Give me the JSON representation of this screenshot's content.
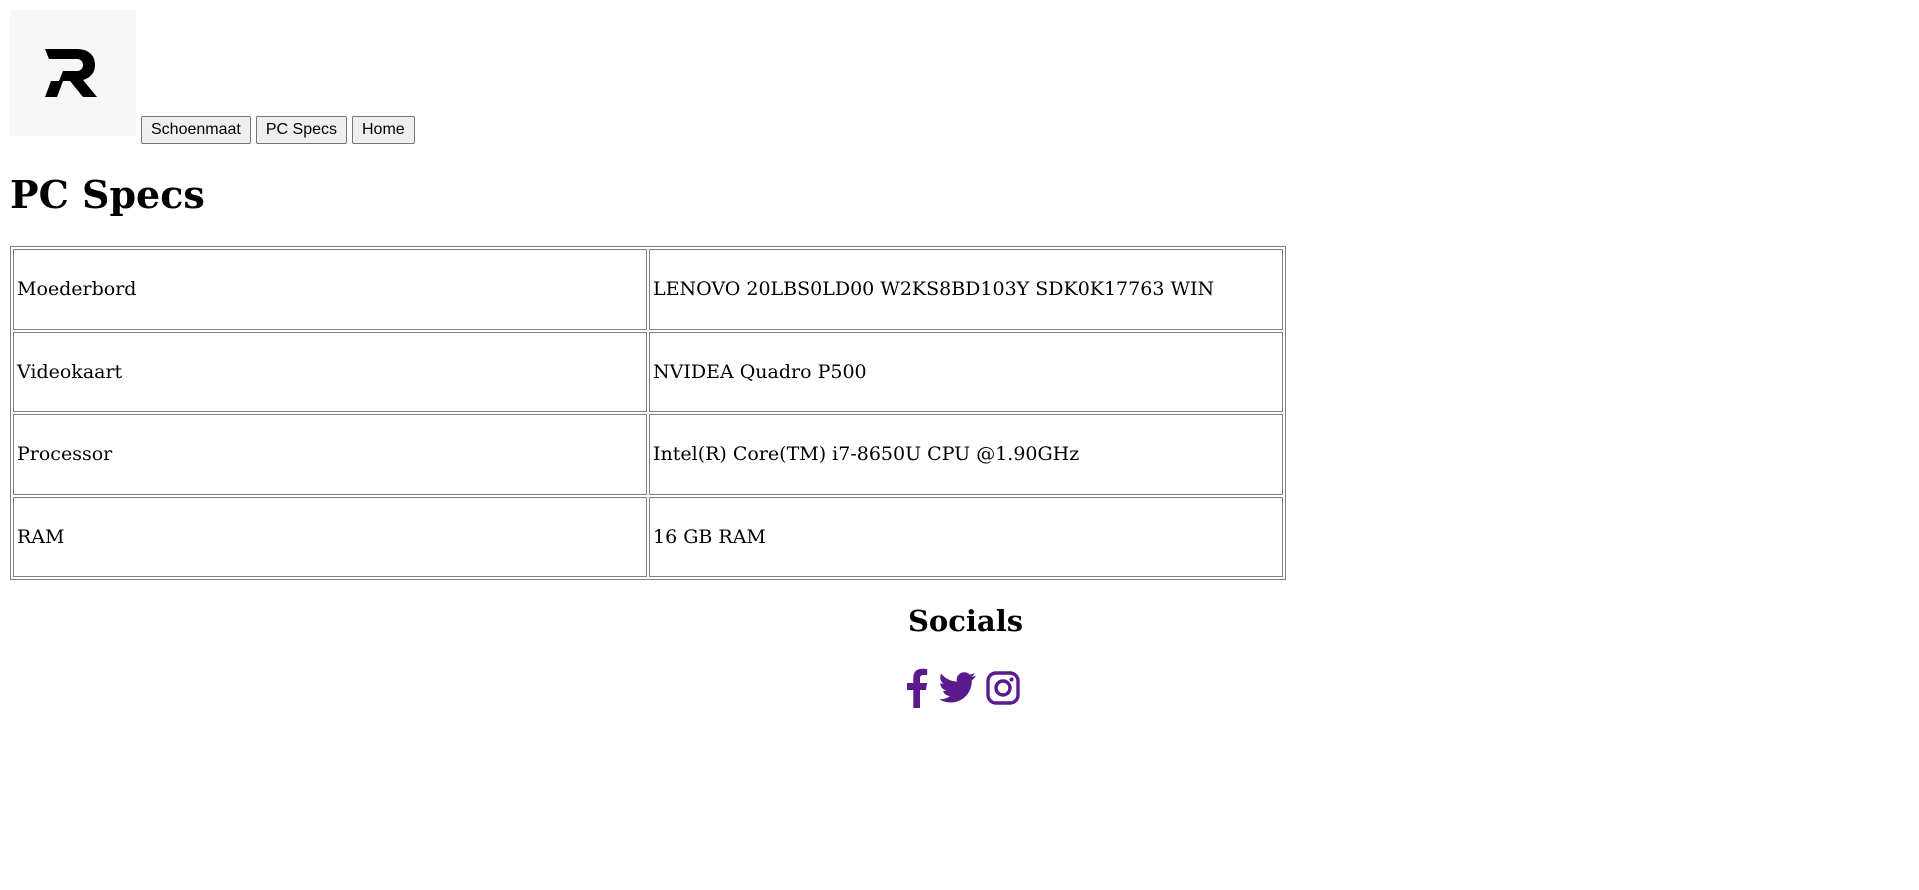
{
  "logo": {
    "icon": "r-letter-logo-icon",
    "letter": "R"
  },
  "nav": {
    "buttons": [
      {
        "label": "Schoenmaat"
      },
      {
        "label": "PC Specs"
      },
      {
        "label": "Home"
      }
    ]
  },
  "main": {
    "title": "PC Specs",
    "specs": [
      {
        "label": "Moederbord",
        "value": "LENOVO 20LBS0LD00 W2KS8BD103Y SDK0K17763 WIN"
      },
      {
        "label": "Videokaart",
        "value": "NVIDEA Quadro P500"
      },
      {
        "label": "Processor",
        "value": "Intel(R) Core(TM) i7-8650U CPU @1.90GHz"
      },
      {
        "label": "RAM",
        "value": "16 GB RAM"
      }
    ]
  },
  "footer": {
    "socials_title": "Socials",
    "icons": [
      "facebook-icon",
      "twitter-icon",
      "instagram-icon"
    ],
    "icon_color": "#5a1a8c"
  }
}
